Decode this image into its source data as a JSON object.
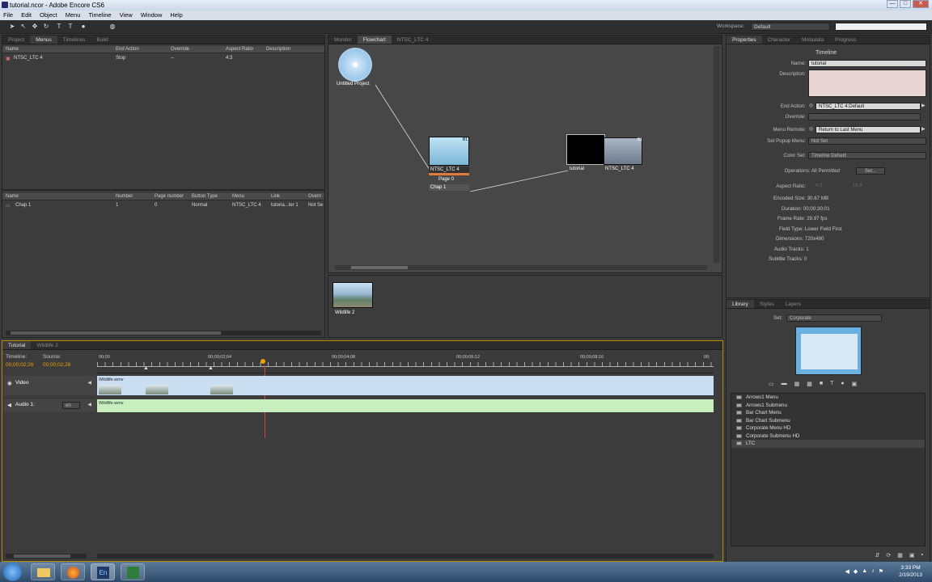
{
  "window": {
    "title": "tutorial.ncor - Adobe Encore CS6",
    "buttons": [
      "—",
      "□",
      "✕"
    ]
  },
  "menu": [
    "File",
    "Edit",
    "Object",
    "Menu",
    "Timeline",
    "View",
    "Window",
    "Help"
  ],
  "toolbar": {
    "workspace_label": "Workspace:",
    "workspace_value": "Default"
  },
  "project_panel": {
    "tabs": [
      "Project",
      "Menus",
      "Timelines",
      "Build"
    ],
    "menus_columns": [
      "Name",
      "End Action",
      "Override",
      "Aspect Ratio",
      "Description"
    ],
    "menus_rows": [
      {
        "name": "NTSC_LTC 4",
        "end_action": "Stop",
        "override": "--",
        "aspect": "4:3",
        "description": ""
      }
    ],
    "buttons_columns": [
      "Name",
      "Number",
      "Page number",
      "Button Type",
      "Menu",
      "Link",
      "Overri"
    ],
    "buttons_rows": [
      {
        "name": "Chap 1",
        "number": "1",
        "page": "0",
        "type": "Normal",
        "menu": "NTSC_LTC 4",
        "link": "tutoria...ter 1",
        "override": "Not Se"
      }
    ]
  },
  "flowchart_panel": {
    "tabs": [
      "Monitor",
      "Flowchart",
      "NTSC_LTC 4"
    ],
    "disc_label": "Untitled Project",
    "menu_node": {
      "title": "NTSC_LTC 4",
      "page": "Page 0",
      "chapter": "Chap 1",
      "badge": "B1"
    },
    "timeline_node": {
      "left_label": "tutorial",
      "right_label": "NTSC_LTC 4",
      "badge": "B1"
    },
    "asset_label": "Wildlife 2"
  },
  "properties_panel": {
    "tabs": [
      "Properties",
      "Character",
      "Metadata",
      "Progress"
    ],
    "section_title": "Timeline",
    "name_label": "Name:",
    "name_value": "tutorial",
    "description_label": "Description:",
    "end_action_label": "End Action:",
    "end_action_value": "NTSC_LTC 4:Default",
    "override_label": "Override:",
    "override_value": "Not Set",
    "menu_remote_label": "Menu Remote:",
    "menu_remote_value": "Return to Last Menu",
    "popup_label": "Set Popup Menu:",
    "popup_value": "Not Set",
    "color_set_label": "Color Set:",
    "color_set_value": "Timeline Default",
    "operations_label": "Operations: All Permitted",
    "set_button": "Set...",
    "aspect_label": "Aspect Ratio:",
    "aspect_a": "4:3",
    "aspect_b": "16:9",
    "info": [
      "Encoded Size: 30.67 MB",
      "Duration: 00;00;30;01",
      "Frame Rate: 29.97 fps",
      "Field Type: Lower Field First",
      "Dimensions: 720x480",
      "Audio Tracks: 1",
      "Subtitle Tracks: 0"
    ]
  },
  "library_panel": {
    "tabs": [
      "Library",
      "Styles",
      "Layers"
    ],
    "set_label": "Set:",
    "set_value": "Corporate",
    "items": [
      "Arrows1 Menu",
      "Arrows1 Submenu",
      "Bar Chart Menu",
      "Bar Chart Submenu",
      "Corporate Menu HD",
      "Corporate Submenu HD",
      "LTC"
    ]
  },
  "timeline_panel": {
    "tabs": [
      "Tutorial",
      "Wildlife 2"
    ],
    "timeline_label": "Timeline:",
    "source_label": "Source:",
    "timeline_tc": "00;00;02;26",
    "source_tc": "00;00;02;26",
    "ruler": [
      "00;00",
      "00;00;02;04",
      "00;00;04;08",
      "00;00;06;12",
      "00;00;08;16",
      "00;"
    ],
    "video_track": "Video",
    "audio_track": "Audio 1:",
    "audio_lang": "en",
    "clip_name": "Wildlife.wmv"
  },
  "taskbar": {
    "lang": "En",
    "time": "3:33 PM",
    "date": "2/19/2013"
  },
  "colors": {
    "accent": "#f0a000",
    "video_track": "#c9def0",
    "audio_track": "#c8eec0"
  }
}
